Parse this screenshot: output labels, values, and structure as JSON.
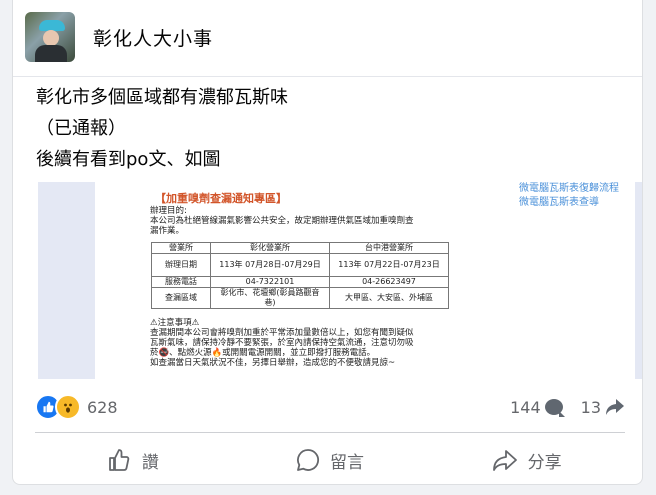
{
  "post": {
    "page_name": "彰化人大小事",
    "lines": [
      "彰化市多個區域都有濃郁瓦斯味",
      "（已通報）",
      "後續有看到po文、如圖"
    ]
  },
  "notice": {
    "links": [
      "微電腦瓦斯表復歸流程",
      "微電腦瓦斯表查導"
    ],
    "title": "【加重嗅劑查漏通知專區】",
    "purpose_label": "辦理目的:",
    "purpose_text": [
      "本公司為杜絕管線漏氣影響公共安全，故定期辦理供氣區域加重嗅劑查",
      "漏作業。"
    ],
    "table": {
      "headers": [
        "營業所",
        "彰化營業所",
        "台中港營業所"
      ],
      "rows": [
        [
          "辦理日期",
          "113年 07月28日-07月29日",
          "113年 07月22日-07月23日"
        ],
        [
          "服務電話",
          "04-7322101",
          "04-26623497"
        ],
        [
          "查漏區域",
          "彰化市、花壇鄉(彰員路觀音巷)",
          "大甲區、大安區、外埔區"
        ]
      ]
    },
    "caution_title": "⚠注意事項⚠",
    "caution_lines": [
      "查漏期間本公司會將嗅劑加重於平常添加量數倍以上，如您有聞到疑似",
      "瓦斯氣味，請保持冷靜不要緊張，於室內請保持空氣流通，注意切勿吸",
      "菸🚭、點燃火源🔥或開關電源開關，並立即撥打服務電話。",
      "如查漏當日天氣狀況不佳，另擇日舉辦，造成您的不便敬請見諒~"
    ]
  },
  "stats": {
    "reactions": "628",
    "comments": "144",
    "shares": "13"
  },
  "actions": {
    "like": "讚",
    "comment": "留言",
    "share": "分享"
  },
  "colors": {
    "like_blue": "#1877f2",
    "wow_yellow": "#f7b928",
    "notice_title": "#d2552a",
    "link_blue": "#4a90d9"
  }
}
